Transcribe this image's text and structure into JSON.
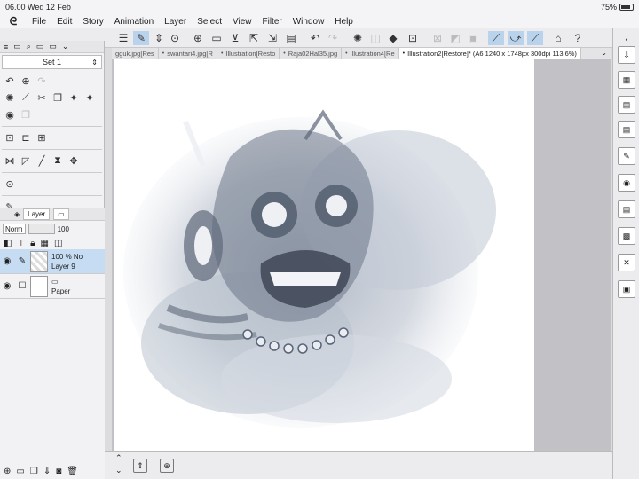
{
  "status": {
    "time": "06.00",
    "date": "Wed 12 Feb",
    "battery": "75%"
  },
  "app": {
    "logo_icon": "clip-studio-logo-icon"
  },
  "menu": [
    "File",
    "Edit",
    "Story",
    "Animation",
    "Layer",
    "Select",
    "View",
    "Filter",
    "Window",
    "Help"
  ],
  "subtool": {
    "set_name": "Set 1"
  },
  "layer_panel": {
    "tab_label": "Layer",
    "blend_mode": "Norm",
    "opacity": "100",
    "layers": [
      {
        "opacity_mode": "100 % No",
        "name": "Layer 9",
        "selected": true
      },
      {
        "opacity_mode": "",
        "name": "Paper",
        "selected": false
      }
    ]
  },
  "doc_tabs": [
    {
      "label": "gguk.jpg[Res"
    },
    {
      "label": "swantari4.jpg[R"
    },
    {
      "label": "Illustration[Resto"
    },
    {
      "label": "Raja02Hal35.jpg"
    },
    {
      "label": "Illustration4[Re"
    },
    {
      "label": "Illustration2[Restore]* (A6 1240 x 1748px 300dpi 113.6%)",
      "active": true
    }
  ],
  "colors": {
    "accent": "#b9d3ec",
    "selected_layer": "#c5dcf2",
    "canvas_bg": "#c2c2c6",
    "ink": "#4a5568"
  }
}
